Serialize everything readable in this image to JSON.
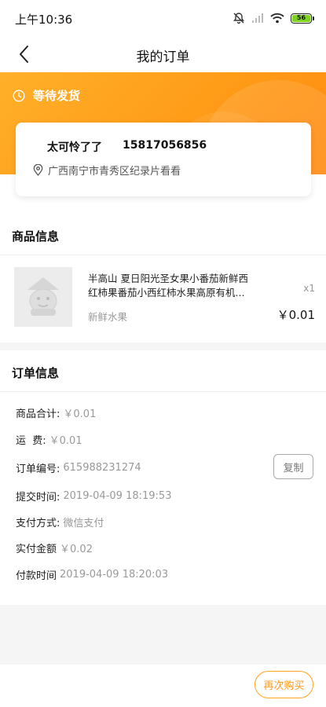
{
  "status_bar": {
    "time": "上午10:36",
    "battery": "56",
    "icons": [
      "mute-icon",
      "signal-icon",
      "wifi-icon",
      "battery-icon"
    ]
  },
  "nav": {
    "title": "我的订单",
    "back_icon": "chevron-left-icon"
  },
  "order_status": {
    "text": "等待发货",
    "icon": "clock-icon"
  },
  "address": {
    "name": "太可怜了了",
    "phone": "15817056856",
    "detail": "广西南宁市青秀区纪录片看看",
    "icon": "location-pin-icon"
  },
  "goods": {
    "section_title": "商品信息",
    "item": {
      "name": "半高山 夏日阳光圣女果小番茄新鲜西红柿果番茄小西红柿水果高原有机...",
      "category": "新鲜水果",
      "quantity": "x1",
      "price": "￥0.01"
    }
  },
  "order_info": {
    "section_title": "订单信息",
    "rows": [
      {
        "label": "商品合计:",
        "value": "￥0.01"
      },
      {
        "label": "运  费:",
        "value": "￥0.01"
      },
      {
        "label": "订单编号:",
        "value": "615988231274"
      },
      {
        "label": "提交时间:",
        "value": "2019-04-09 18:19:53"
      },
      {
        "label": "支付方式:",
        "value": "微信支付"
      },
      {
        "label": "实付金额",
        "value": "￥0.02"
      },
      {
        "label": "付款时间",
        "value": "2019-04-09 18:20:03"
      }
    ],
    "copy_label": "复制"
  },
  "actions": {
    "rebuy_label": "再次购买"
  },
  "colors": {
    "accent": "#ff9a1a",
    "header_gradient_start": "#ffb02a",
    "header_gradient_end": "#ff8a10",
    "battery_green": "#7ed321"
  }
}
